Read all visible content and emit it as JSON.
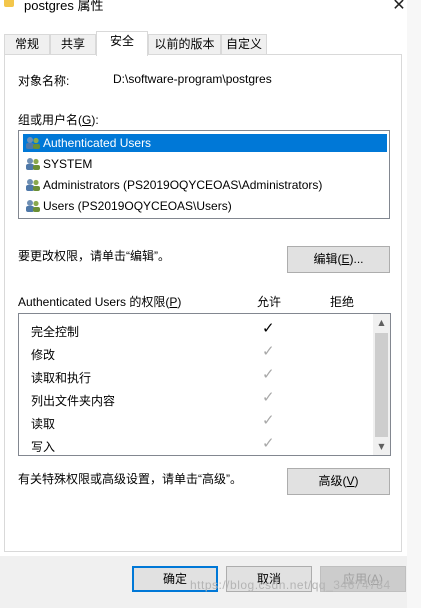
{
  "window": {
    "title": "postgres 属性",
    "close_glyph": "✕"
  },
  "tabs": [
    {
      "label": "常规",
      "active": false
    },
    {
      "label": "共享",
      "active": false
    },
    {
      "label": "安全",
      "active": true
    },
    {
      "label": "以前的版本",
      "active": false
    },
    {
      "label": "自定义",
      "active": false
    }
  ],
  "security": {
    "object_name_label": "对象名称:",
    "object_name_value": "D:\\software-program\\postgres",
    "group_label": "组或用户名(",
    "group_label_key": "G",
    "group_label_tail": "):",
    "principals": [
      {
        "name": "Authenticated Users",
        "selected": true,
        "icon": "users-icon"
      },
      {
        "name": "SYSTEM",
        "selected": false,
        "icon": "users-icon"
      },
      {
        "name": "Administrators (PS2019OQYCEOAS\\Administrators)",
        "selected": false,
        "icon": "users-icon"
      },
      {
        "name": "Users (PS2019OQYCEOAS\\Users)",
        "selected": false,
        "icon": "users-icon"
      }
    ],
    "change_hint": "要更改权限，请单击“编辑”。",
    "edit_button": {
      "label": "编辑(",
      "key": "E",
      "tail": ")..."
    },
    "permissions_label": "Authenticated Users 的权限(",
    "permissions_label_key": "P",
    "permissions_label_tail": ")",
    "allow_header": "允许",
    "deny_header": "拒绝",
    "check_glyph": "✓",
    "permissions": [
      {
        "name": "完全控制",
        "allow": "explicit"
      },
      {
        "name": "修改",
        "allow": "inherited"
      },
      {
        "name": "读取和执行",
        "allow": "inherited"
      },
      {
        "name": "列出文件夹内容",
        "allow": "inherited"
      },
      {
        "name": "读取",
        "allow": "inherited"
      },
      {
        "name": "写入",
        "allow": "inherited"
      }
    ],
    "advanced_hint": "有关特殊权限或高级设置，请单击“高级”。",
    "advanced_button": {
      "label": "高级(",
      "key": "V",
      "tail": ")"
    },
    "scroll_up": "▲",
    "scroll_down": "▼"
  },
  "footer": {
    "ok": "确定",
    "cancel": "取消",
    "apply": {
      "label": "应用(",
      "key": "A",
      "tail": ")"
    }
  },
  "watermark": "https://blog.csdn.net/qq_34674784",
  "colors": {
    "selection": "#0078d7",
    "folder": "#f3c64b"
  }
}
